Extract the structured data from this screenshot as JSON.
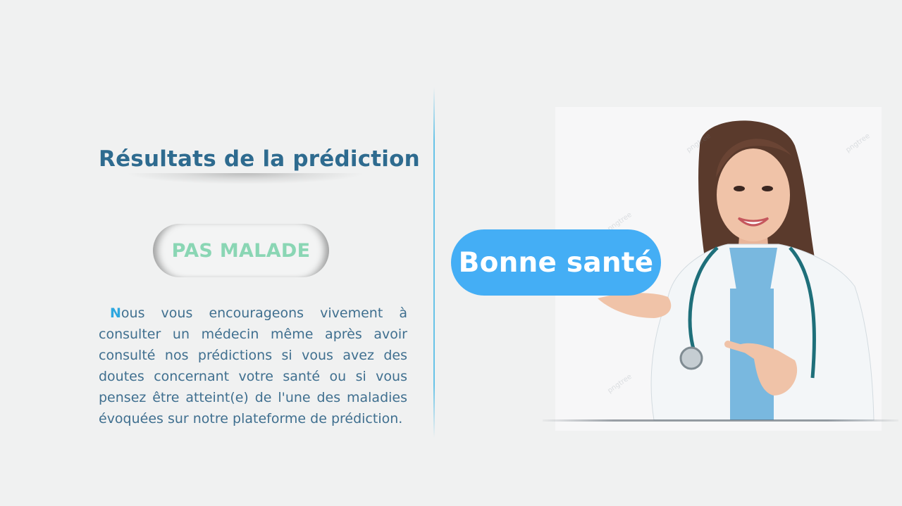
{
  "result": {
    "title": "Résultats de la prédiction",
    "status_label": "PAS MALADE",
    "message_first_letter": "N",
    "message_rest": "ous vous encourageons vivement à consulter un médecin même après avoir consulté nos prédictions si vous avez des doutes concernant votre santé ou si vous pensez être atteint(e) de l'une des maladies évoquées sur notre plateforme de prédiction."
  },
  "illustration": {
    "badge_text": "Bonne santé",
    "watermark_text": "pngtree"
  },
  "colors": {
    "title": "#2e6b8f",
    "status": "#8ad6b4",
    "message": "#3f6f8f",
    "dropcap": "#2ea7df",
    "badge_bg": "#44aef5",
    "background": "#f0f1f1"
  },
  "icons": {
    "image": "doctor-illustration"
  }
}
